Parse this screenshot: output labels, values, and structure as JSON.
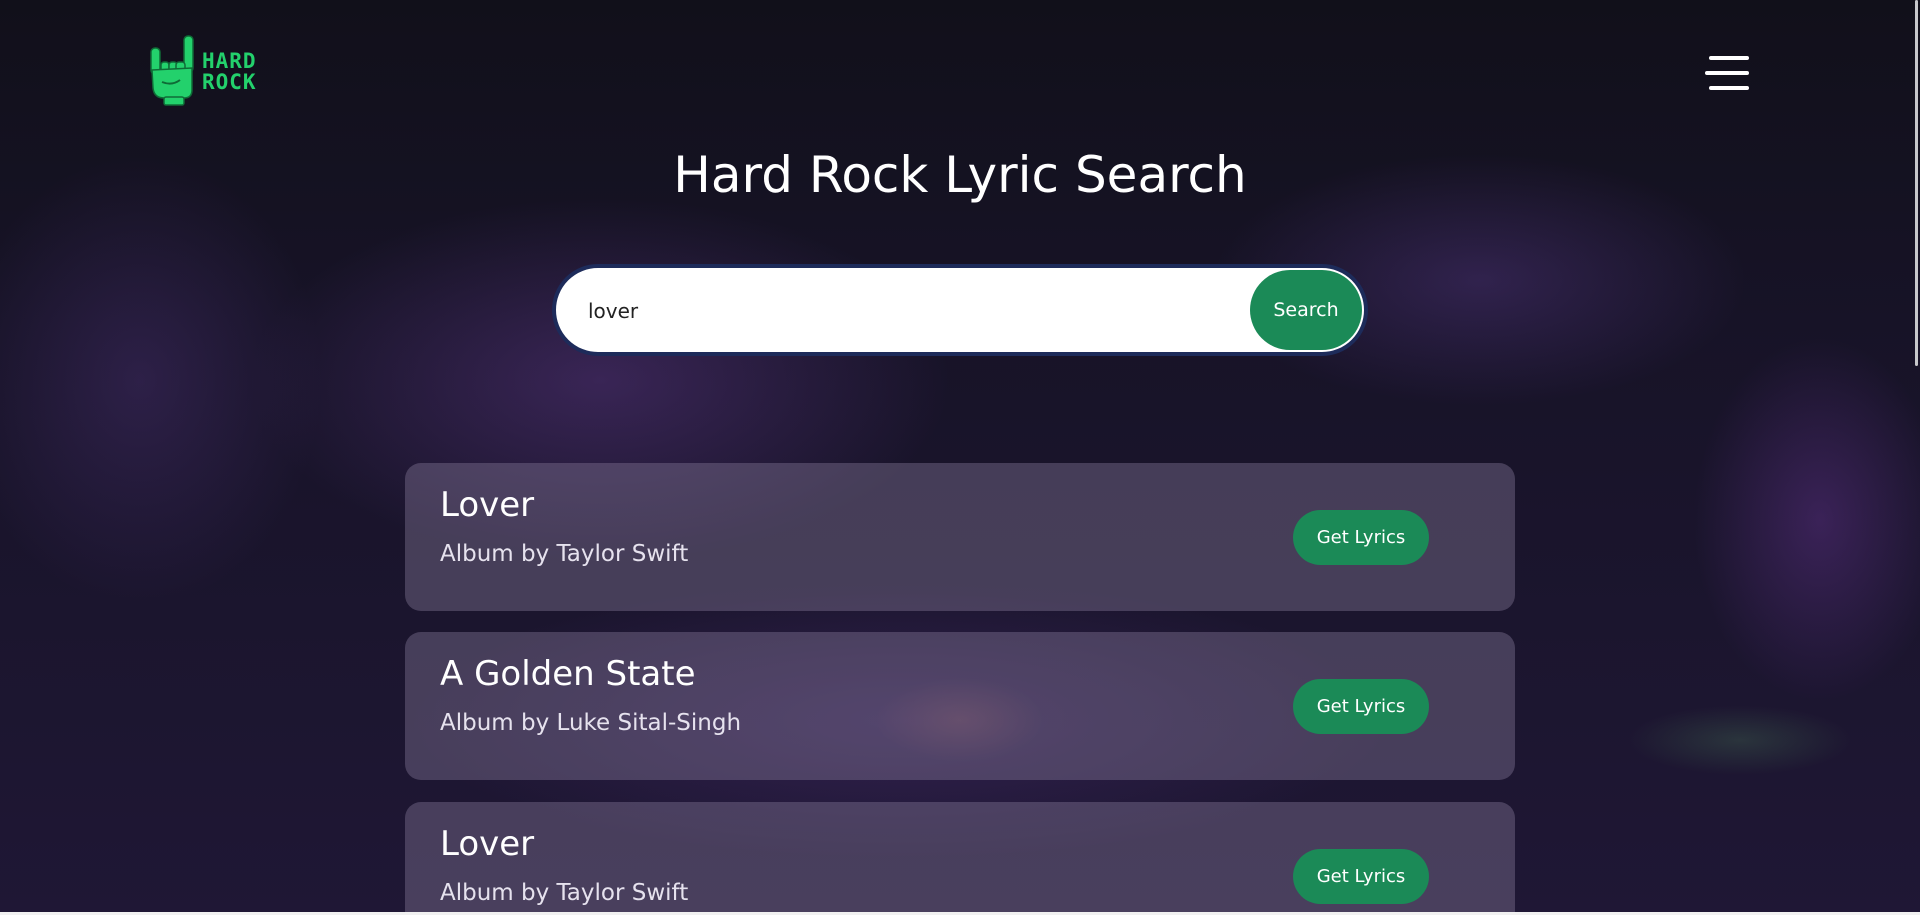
{
  "header": {
    "logo_line1": "HARD",
    "logo_line2": "ROCK",
    "logo_color": "#23d16c",
    "menu_icon": "hamburger-menu-icon"
  },
  "title": "Hard Rock Lyric Search",
  "search": {
    "value": "lover",
    "placeholder": "",
    "button_label": "Search"
  },
  "results": [
    {
      "title": "Lover",
      "subtitle": "Album by Taylor Swift",
      "button_label": "Get Lyrics"
    },
    {
      "title": "A Golden State",
      "subtitle": "Album by Luke Sital-Singh",
      "button_label": "Get Lyrics"
    },
    {
      "title": "Lover",
      "subtitle": "Album by Taylor Swift",
      "button_label": "Get Lyrics"
    }
  ],
  "colors": {
    "accent": "#1b8a57",
    "search_border": "#1d2b5a"
  }
}
